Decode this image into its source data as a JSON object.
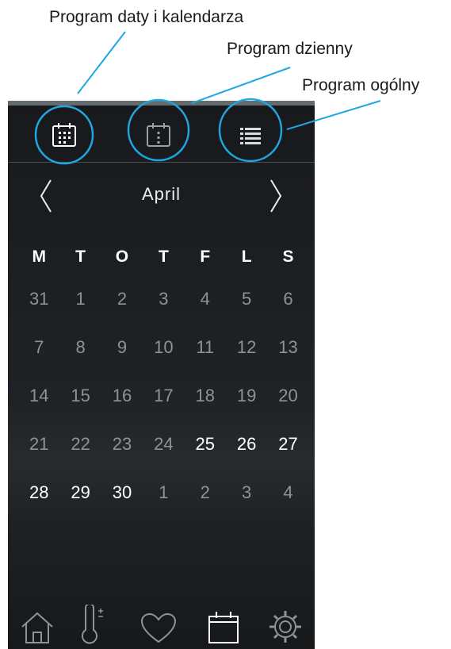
{
  "callouts": {
    "calendar_program": "Program daty i kalendarza",
    "day_program": "Program dzienny",
    "general_program": "Program ogólny"
  },
  "tabs": [
    {
      "icon": "calendar-dates-icon",
      "active": true
    },
    {
      "icon": "calendar-day-icon",
      "active": false
    },
    {
      "icon": "list-icon",
      "active": false
    }
  ],
  "month": "April",
  "weekdays": [
    "M",
    "T",
    "O",
    "T",
    "F",
    "L",
    "S"
  ],
  "weeks": [
    [
      {
        "d": "31",
        "a": false
      },
      {
        "d": "1",
        "a": false
      },
      {
        "d": "2",
        "a": false
      },
      {
        "d": "3",
        "a": false
      },
      {
        "d": "4",
        "a": false
      },
      {
        "d": "5",
        "a": false
      },
      {
        "d": "6",
        "a": false
      }
    ],
    [
      {
        "d": "7",
        "a": false
      },
      {
        "d": "8",
        "a": false
      },
      {
        "d": "9",
        "a": false
      },
      {
        "d": "10",
        "a": false
      },
      {
        "d": "11",
        "a": false
      },
      {
        "d": "12",
        "a": false
      },
      {
        "d": "13",
        "a": false
      }
    ],
    [
      {
        "d": "14",
        "a": false
      },
      {
        "d": "15",
        "a": false
      },
      {
        "d": "16",
        "a": false
      },
      {
        "d": "17",
        "a": false
      },
      {
        "d": "18",
        "a": false
      },
      {
        "d": "19",
        "a": false
      },
      {
        "d": "20",
        "a": false
      }
    ],
    [
      {
        "d": "21",
        "a": false
      },
      {
        "d": "22",
        "a": false
      },
      {
        "d": "23",
        "a": false
      },
      {
        "d": "24",
        "a": false
      },
      {
        "d": "25",
        "a": true
      },
      {
        "d": "26",
        "a": true
      },
      {
        "d": "27",
        "a": true
      }
    ],
    [
      {
        "d": "28",
        "a": true
      },
      {
        "d": "29",
        "a": true
      },
      {
        "d": "30",
        "a": true
      },
      {
        "d": "1",
        "a": false
      },
      {
        "d": "2",
        "a": false
      },
      {
        "d": "3",
        "a": false
      },
      {
        "d": "4",
        "a": false
      }
    ]
  ],
  "bottom_nav": [
    "home-icon",
    "thermometer-icon",
    "heart-icon",
    "calendar-icon",
    "gear-icon"
  ],
  "colors": {
    "highlight_circle": "#1ea7e1",
    "active_text": "#ffffff",
    "inactive_text": "#8d9396"
  }
}
